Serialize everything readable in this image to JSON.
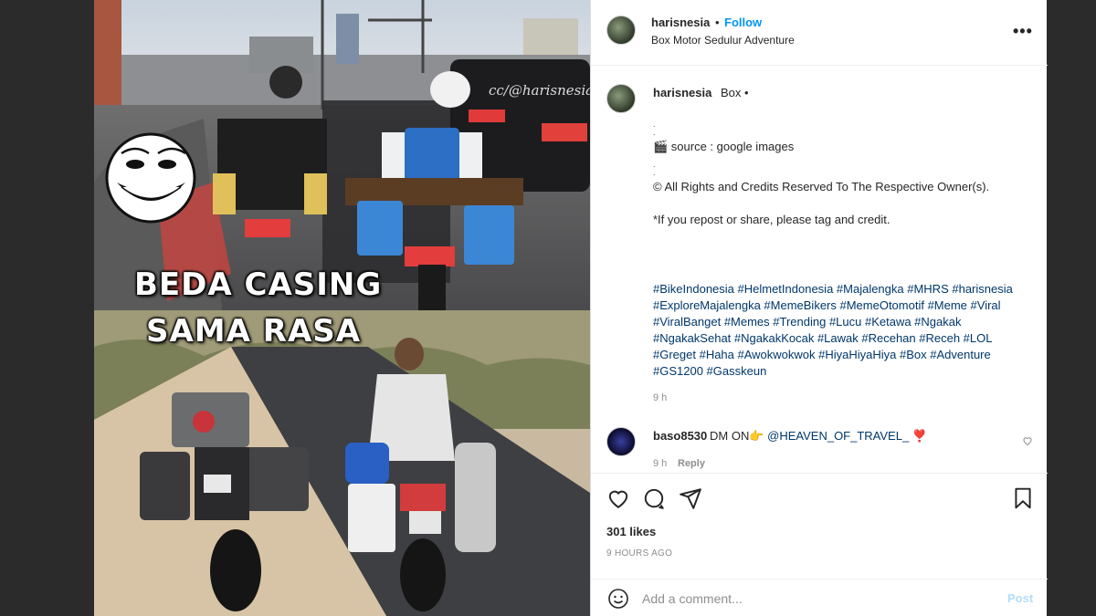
{
  "header": {
    "username": "harisnesia",
    "separator": "•",
    "follow_label": "Follow",
    "location": "Box Motor Sedulur Adventure",
    "more_label": "•••"
  },
  "photo": {
    "watermark": "cc/@harisnesia",
    "meme_line_1": "BEDA CASING",
    "meme_line_2": "SAMA RASA"
  },
  "caption": {
    "username": "harisnesia",
    "suffix": "Box •",
    "dot": ".",
    "source": "🎬 source : google images",
    "rights": "© All Rights and Credits Reserved To The Respective Owner(s).",
    "repost": "*If you repost or share, please tag and credit.",
    "hashtags": "#BikeIndonesia #HelmetIndonesia #Majalengka #MHRS #harisnesia #ExploreMajalengka #MemeBikers #MemeOtomotif #Meme #Viral #ViralBanget #Memes #Trending #Lucu #Ketawa #Ngakak #NgakakSehat #NgakakKocak #Lawak #Recehan #Receh #LOL #Greget #Haha #Awokwokwok #HiyaHiyaHiya #Box #Adventure #GS1200 #Gasskeun",
    "time": "9 h"
  },
  "comment": {
    "username": "baso8530",
    "text": "DM ON👉",
    "mention": "@HEAVEN_OF_TRAVEL_",
    "emoji": "❣️",
    "time": "9 h",
    "reply_label": "Reply"
  },
  "actions": {
    "likes": "301 likes",
    "time": "9 HOURS AGO"
  },
  "comment_bar": {
    "placeholder": "Add a comment...",
    "post_label": "Post"
  }
}
